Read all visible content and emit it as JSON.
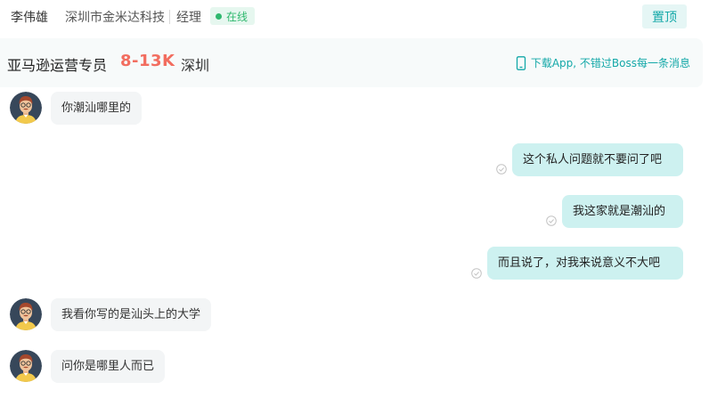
{
  "header": {
    "contact_name": "李伟雄",
    "company": "深圳市金米达科技",
    "role": "经理",
    "status": "在线",
    "pin_button": "置顶"
  },
  "job": {
    "title": "亚马逊运营专员",
    "salary": "8-13K",
    "city": "深圳",
    "download_prompt": "下载App, 不错过Boss每一条消息"
  },
  "messages": [
    {
      "side": "left",
      "text": "你潮汕哪里的"
    },
    {
      "side": "right",
      "text": "这个私人问题就不要问了吧",
      "read_icon": "check-circle-icon"
    },
    {
      "side": "right",
      "text": "我这家就是潮汕的",
      "read_icon": "check-circle-icon"
    },
    {
      "side": "right",
      "text": "而且说了，对我来说意义不大吧",
      "read_icon": "check-circle-icon"
    },
    {
      "side": "left",
      "text": "我看你写的是汕头上的大学"
    },
    {
      "side": "left",
      "text": "问你是哪里人而已"
    }
  ],
  "colors": {
    "accent": "#13a8a8",
    "online": "#2fb86e",
    "salary": "#f26d5f",
    "bubble_right": "#cdf1f0",
    "bubble_left": "#f3f5f6"
  }
}
